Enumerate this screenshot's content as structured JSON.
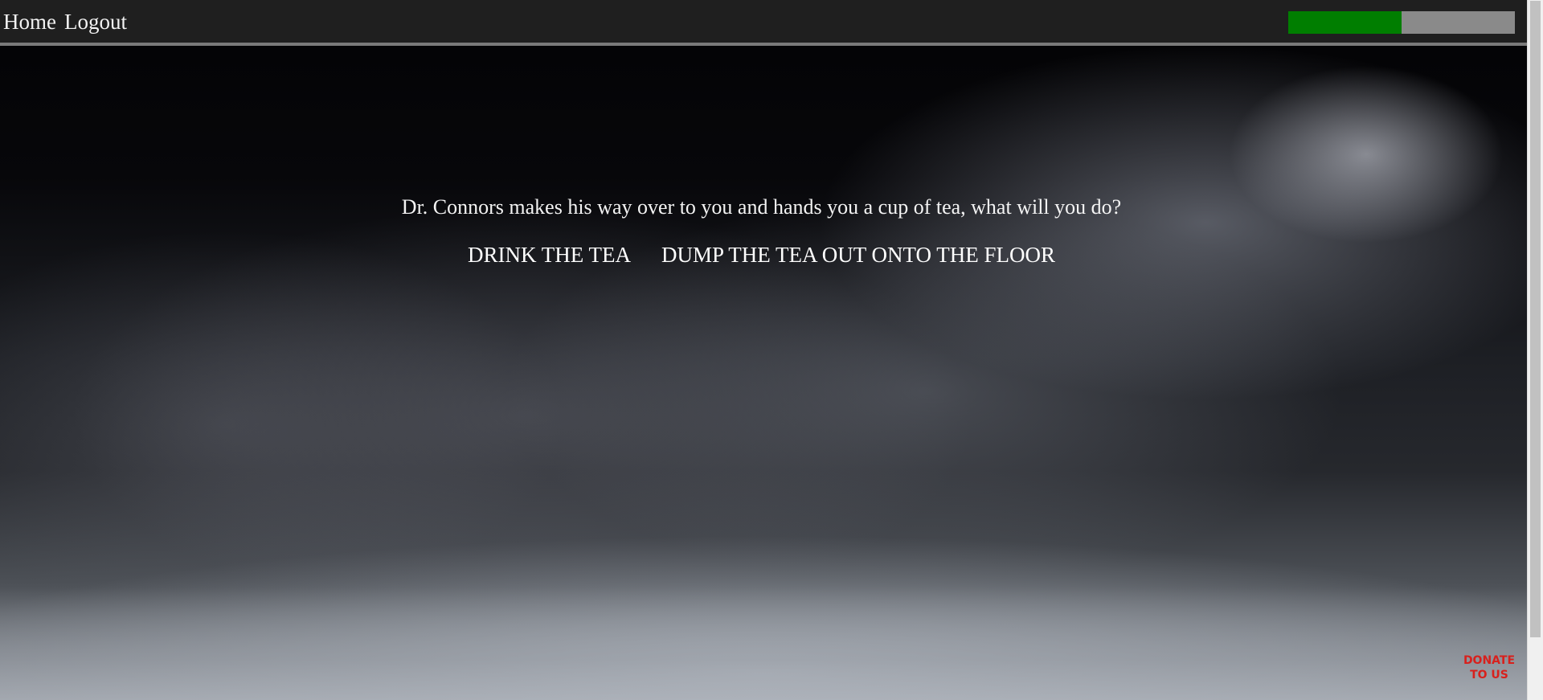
{
  "nav": {
    "home_label": "Home",
    "logout_label": "Logout"
  },
  "progress": {
    "fraction": 0.5,
    "fill_color": "#007e00",
    "track_color": "#8a8a8a"
  },
  "story": {
    "text": "Dr. Connors makes his way over to you and hands you a cup of tea, what will you do?"
  },
  "choices": [
    {
      "label": "DRINK THE TEA"
    },
    {
      "label": "DUMP THE TEA OUT ONTO THE FLOOR"
    }
  ],
  "donate": {
    "line1": "DONATE",
    "line2": "TO US",
    "color": "#d8201c"
  }
}
